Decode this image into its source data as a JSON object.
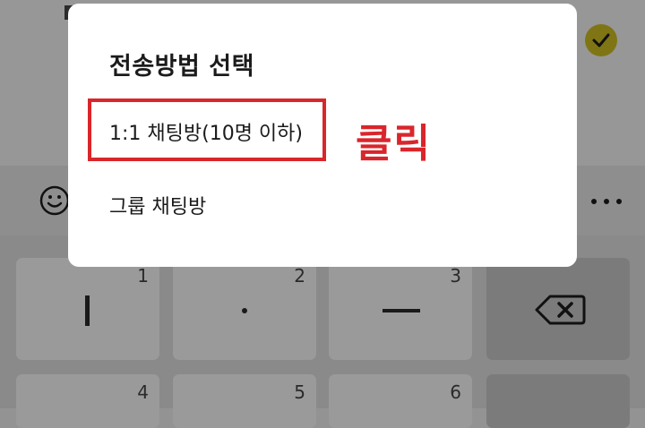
{
  "dialog": {
    "title": "전송방법 선택",
    "options": [
      {
        "label": "1:1 채팅방(10명 이하)"
      },
      {
        "label": "그룹 채팅방"
      }
    ]
  },
  "annotation": {
    "text": "클릭",
    "color": "#d9262b"
  },
  "keyboard": {
    "keys": [
      {
        "num": "1",
        "symbol": "vertical-bar"
      },
      {
        "num": "2",
        "symbol": "dot"
      },
      {
        "num": "3",
        "symbol": "dash"
      },
      {
        "num": "",
        "symbol": "backspace-icon"
      },
      {
        "num": "4"
      },
      {
        "num": "5"
      },
      {
        "num": "6"
      }
    ]
  },
  "toolbar": {
    "icons": [
      "smiley-icon",
      "more-icon"
    ]
  },
  "header": {
    "icons": [
      "check-icon"
    ],
    "accent_color": "#7f7514"
  }
}
